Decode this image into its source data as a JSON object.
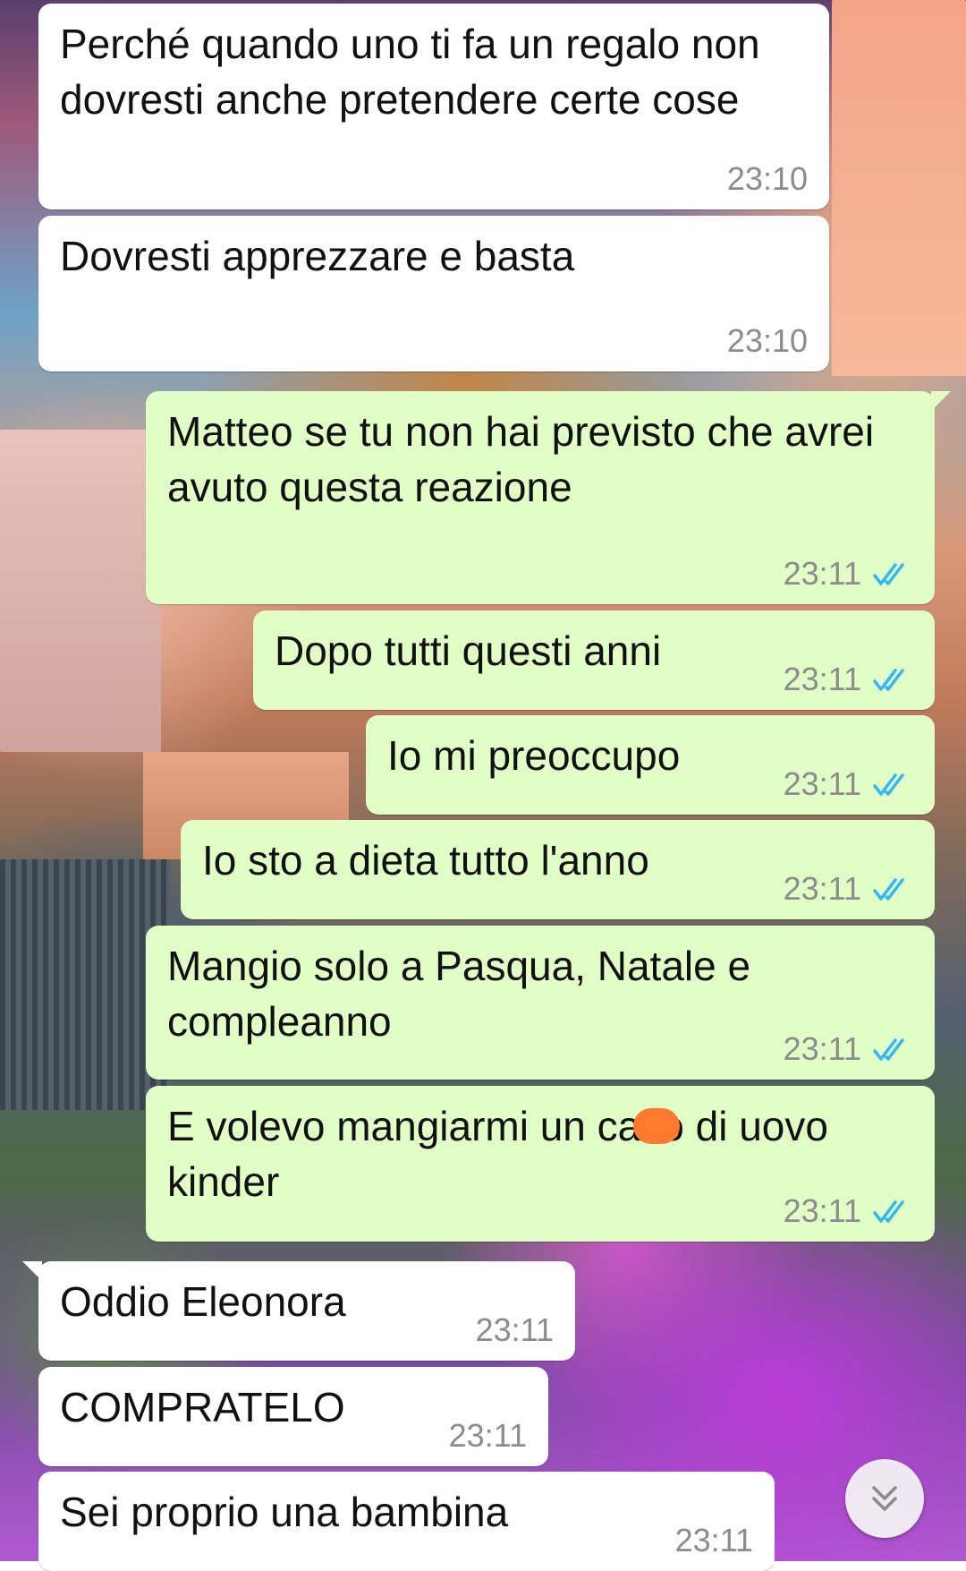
{
  "messages": [
    {
      "dir": "in",
      "text": "Perché quando uno ti fa un regalo non dovresti anche pretendere certe cose",
      "time": "23:10"
    },
    {
      "dir": "in",
      "text": "Dovresti apprezzare e basta",
      "time": "23:10"
    },
    {
      "dir": "out",
      "text": "Matteo se tu non hai previsto che avrei avuto questa reazione",
      "time": "23:11",
      "status": "read"
    },
    {
      "dir": "out",
      "text": "Dopo tutti questi anni",
      "time": "23:11",
      "status": "read"
    },
    {
      "dir": "out",
      "text": "Io mi preoccupo",
      "time": "23:11",
      "status": "read"
    },
    {
      "dir": "out",
      "text": "Io sto a dieta tutto l'anno",
      "time": "23:11",
      "status": "read"
    },
    {
      "dir": "out",
      "text": "Mangio solo a Pasqua, Natale e compleanno",
      "time": "23:11",
      "status": "read"
    },
    {
      "dir": "out",
      "text_before": "E volevo mangiarmi un ca",
      "text_after": "zo di uovo kinder",
      "time": "23:11",
      "status": "read"
    },
    {
      "dir": "in",
      "text": "Oddio Eleonora",
      "time": "23:11"
    },
    {
      "dir": "in",
      "text": "COMPRATELO",
      "time": "23:11"
    },
    {
      "dir": "in",
      "text": "Sei proprio una bambina",
      "time": "23:11"
    }
  ],
  "colors": {
    "incoming_bubble": "#ffffff",
    "outgoing_bubble": "#e1fec6",
    "timestamp": "#8c8c8c",
    "read_ticks": "#34b7f1",
    "censor": "#ff7a2e"
  },
  "icons": {
    "read_status": "double-check-icon",
    "scroll_down": "chevron-double-down-icon"
  }
}
